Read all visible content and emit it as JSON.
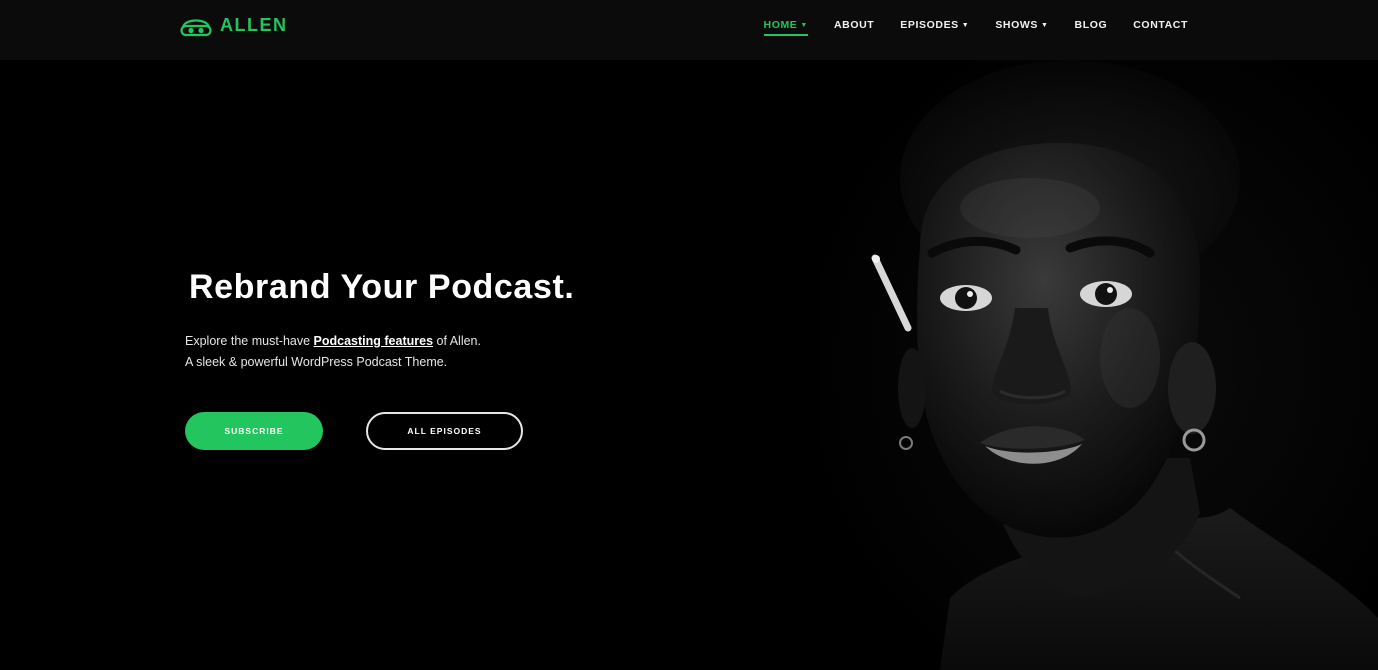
{
  "brand": {
    "name": "ALLEN",
    "accent_color": "#22c55e",
    "logo_icon": "headphones-icon"
  },
  "nav": {
    "items": [
      {
        "label": "HOME",
        "has_dropdown": true,
        "active": true
      },
      {
        "label": "ABOUT",
        "has_dropdown": false,
        "active": false
      },
      {
        "label": "EPISODES",
        "has_dropdown": true,
        "active": false
      },
      {
        "label": "SHOWS",
        "has_dropdown": true,
        "active": false
      },
      {
        "label": "BLOG",
        "has_dropdown": false,
        "active": false
      },
      {
        "label": "CONTACT",
        "has_dropdown": false,
        "active": false
      }
    ],
    "caret_icon": "chevron-down-icon"
  },
  "hero": {
    "title": "Rebrand Your Podcast.",
    "line1_prefix": "Explore the must-have ",
    "line1_link": "Podcasting features",
    "line1_suffix": " of Allen.",
    "line2": "A sleek & powerful WordPress Podcast Theme.",
    "primary_button": "SUBSCRIBE",
    "secondary_button": "ALL EPISODES"
  },
  "colors": {
    "background": "#000000",
    "header_background": "#0b0b0b",
    "button_green": "#22c55e"
  }
}
